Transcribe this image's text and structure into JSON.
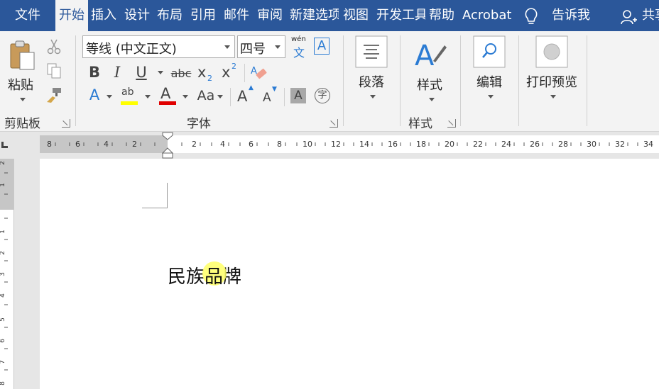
{
  "tabs": [
    {
      "label": "文件",
      "active": false
    },
    {
      "label": "开始",
      "active": true
    },
    {
      "label": "插入",
      "active": false
    },
    {
      "label": "设计",
      "active": false
    },
    {
      "label": "布局",
      "active": false
    },
    {
      "label": "引用",
      "active": false
    },
    {
      "label": "邮件",
      "active": false
    },
    {
      "label": "审阅",
      "active": false
    },
    {
      "label": "新建选项",
      "active": false
    },
    {
      "label": "视图",
      "active": false
    },
    {
      "label": "开发工具",
      "active": false
    },
    {
      "label": "帮助",
      "active": false
    },
    {
      "label": "Acrobat",
      "active": false
    }
  ],
  "tell_me": {
    "icon": "lightbulb-icon",
    "label": "告诉我"
  },
  "share": {
    "icon": "share-person-icon",
    "label": "共享"
  },
  "ribbon": {
    "clipboard": {
      "paste_label": "粘贴",
      "group_label": "剪贴板",
      "icons": [
        "paste-icon",
        "cut-icon",
        "copy-icon",
        "format-painter-icon"
      ]
    },
    "font": {
      "font_name": "等线 (中文正文)",
      "font_size": "四号",
      "phonetic_top": "wén",
      "phonetic_bottom": "文",
      "char_border": "A",
      "bold": "B",
      "italic": "I",
      "underline": "U",
      "strike": "abc",
      "subscript_base": "x",
      "subscript_mark": "2",
      "superscript_base": "x",
      "superscript_mark": "2",
      "text_effect": "A",
      "highlight": "ab",
      "font_color": "A",
      "change_case": "Aa",
      "grow": "A",
      "shrink": "A",
      "char_shading": "A",
      "enclose": "字",
      "group_label": "字体",
      "highlight_color": "#ffff00",
      "font_color_value": "#e00000"
    },
    "paragraph": {
      "label": "段落",
      "icon": "paragraph-icon"
    },
    "styles": {
      "label": "样式",
      "group_label": "样式",
      "icon": "styles-icon"
    },
    "editing": {
      "label": "编辑",
      "icon": "find-icon"
    },
    "print_preview": {
      "label": "打印预览",
      "icon": "print-preview-icon"
    }
  },
  "ruler": {
    "labels": [
      "8",
      "6",
      "4",
      "2",
      "2",
      "4",
      "6",
      "8",
      "10",
      "12",
      "14",
      "16",
      "18",
      "20",
      "22",
      "24",
      "26",
      "28",
      "30",
      "32",
      "34"
    ]
  },
  "vruler": {
    "labels": [
      "2",
      "1",
      "1",
      "2",
      "3",
      "4",
      "5",
      "6",
      "7",
      "8"
    ]
  },
  "document": {
    "text_before": "民族",
    "text_highlight": "品",
    "text_after": "牌",
    "cursor_highlight_color": "#ffff66"
  },
  "colors": {
    "tabbar": "#2b579a",
    "ribbon": "#f3f3f3",
    "accent_blue": "#2b7bd3"
  }
}
